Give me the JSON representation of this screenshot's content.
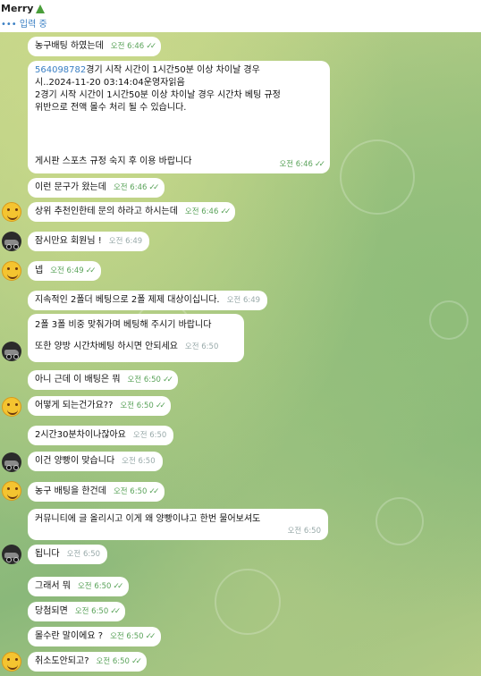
{
  "header": {
    "title": "Merry",
    "status": "••• 입력 중"
  },
  "messages": [
    {
      "text": "농구배팅 하였는데",
      "time": "오전 6:46",
      "read": true
    },
    {
      "link": "564098782",
      "line1": "경기 시작 시간이 1시간50분 이상 차이날 경우",
      "line2": "시..2024-11-20 03:14:04운영자읽음",
      "line3": "2경기 시작 시간이 1시간50분 이상 차이날 경우 시간차 베팅 규정",
      "line4": "위반으로 전액 몰수 처리 될 수 있습니다.",
      "line5": "게시판 스포츠 규정 숙지 후 이용 바랍니다",
      "time": "오전 6:46",
      "read": true
    },
    {
      "text": "이런 문구가 왔는데",
      "time": "오전 6:46",
      "read": true
    },
    {
      "text": "상위 추천인한테 문의 하라고 하시는데",
      "time": "오전 6:46",
      "read": true
    },
    {
      "text": "잠시만요 회원님 !",
      "time": "오전 6:49",
      "read": false
    },
    {
      "text": "넵",
      "time": "오전 6:49",
      "read": true
    },
    {
      "text": "지속적인 2폴더 베팅으로 2폴 제제 대상이십니다.",
      "time": "오전 6:49",
      "read": false
    },
    {
      "line1": "2폴 3폴 비중 맞춰가며 베팅해 주시기 바랍니다",
      "line2": "또한 양방 시간차베팅 하시면 안되세요",
      "time": "오전 6:50",
      "read": false
    },
    {
      "text": "아니 근데 이 배팅은 뭐",
      "time": "오전 6:50",
      "read": true
    },
    {
      "text": "어떻게 되는건가요??",
      "time": "오전 6:50",
      "read": true
    },
    {
      "text": "2시간30분차이나잖아요",
      "time": "오전 6:50",
      "read": false
    },
    {
      "text": "이건 양빵이 맞습니다",
      "time": "오전 6:50",
      "read": false
    },
    {
      "text": "농구 배팅을 한건데",
      "time": "오전 6:50",
      "read": true
    },
    {
      "text": "커뮤니티에 글 올리시고 이게 왜 양빵이냐고 한번 물어보셔도",
      "time": "오전 6:50",
      "read": false
    },
    {
      "text": "됩니다",
      "time": "오전 6:50",
      "read": false
    },
    {
      "text": "그래서 뭐",
      "time": "오전 6:50",
      "read": true
    },
    {
      "text": "당첨되면",
      "time": "오전 6:50",
      "read": true
    },
    {
      "text": "몰수란 말이에요 ?",
      "time": "오전 6:50",
      "read": true
    },
    {
      "text": "취소도안되고?",
      "time": "오전 6:50",
      "read": true
    }
  ],
  "icons": {
    "tick": "double-check-icon",
    "tree": "christmas-tree-icon",
    "smile": "smiley-avatar-icon",
    "car": "car-avatar-icon"
  },
  "colors": {
    "accent": "#5aa35a",
    "link": "#3a7fc4",
    "bubble": "#ffffff"
  }
}
